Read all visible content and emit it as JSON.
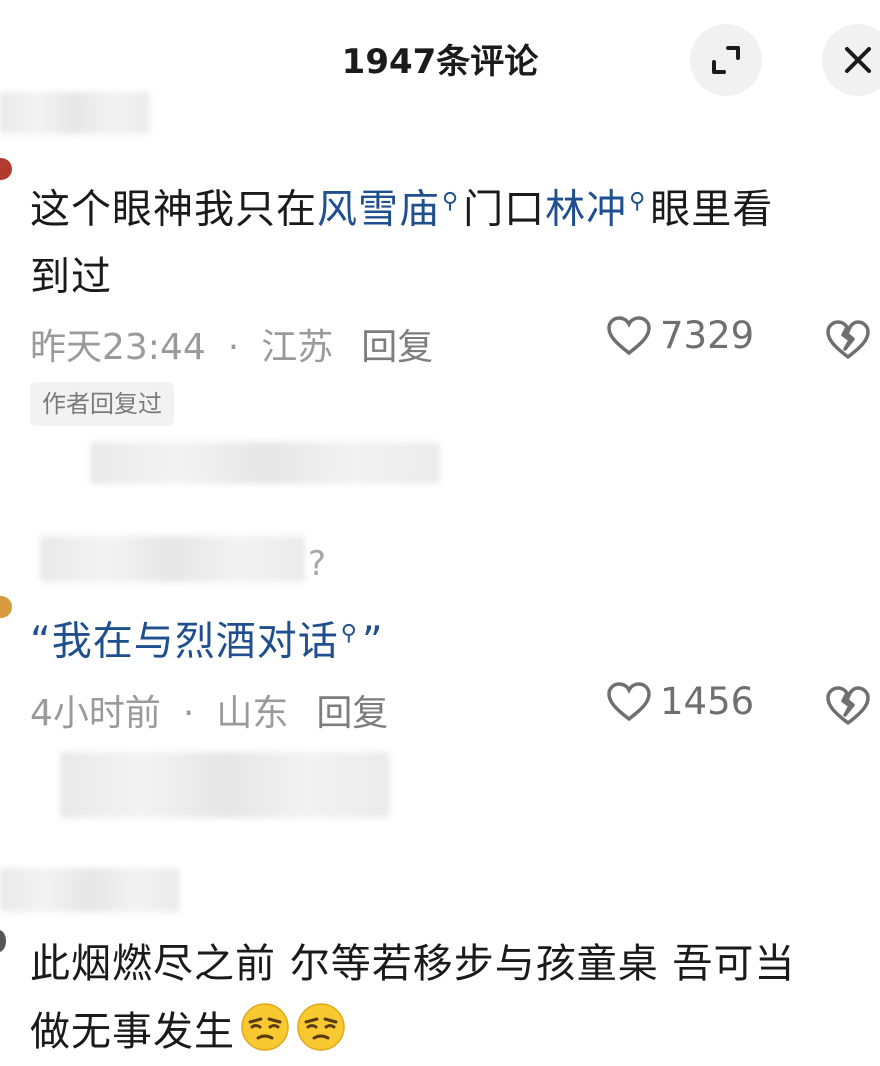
{
  "header": {
    "title": "1947条评论",
    "expand_icon": "expand-icon",
    "close_icon": "close-icon"
  },
  "comments": [
    {
      "text_before": "这个眼神我只在",
      "link1": "风雪庙",
      "text_mid": "门口",
      "link2": "林冲",
      "text_after1": "眼里看",
      "text_after2": "到过",
      "time": "昨天23:44",
      "location": "江苏",
      "reply_label": "回复",
      "likes": "7329",
      "badge": "作者回复过"
    },
    {
      "username_suffix": "?",
      "quote_open": "“",
      "link": "我在与烈酒对话",
      "quote_close": "”",
      "time": "4小时前",
      "location": "山东",
      "reply_label": "回复",
      "likes": "1456"
    },
    {
      "line1": "此烟燃尽之前 尔等若移步与孩童桌 吾可当",
      "line2": "做无事发生",
      "emojis": [
        "smirk-emoji",
        "smirk-emoji"
      ]
    }
  ],
  "separator_dot": "·",
  "colors": {
    "link": "#1f4f8f",
    "meta_gray": "#9a9a9a",
    "badge_bg": "#f2f2f2"
  }
}
